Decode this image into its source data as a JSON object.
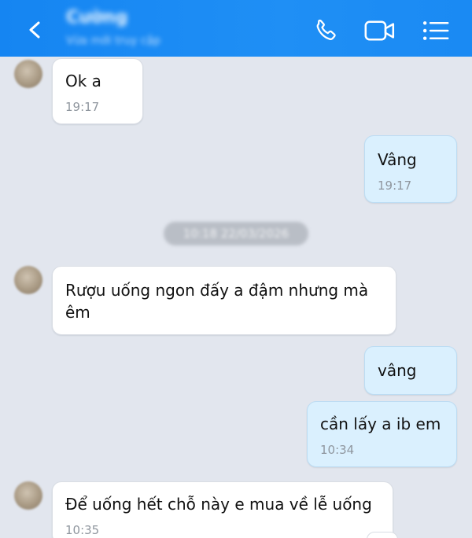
{
  "header": {
    "contact_name": "Cường",
    "status": "Vừa mới truy cập",
    "icons": [
      "back-icon",
      "call-icon",
      "video-call-icon",
      "menu-icon"
    ]
  },
  "date_separator": "10:18 22/03/2026",
  "messages": [
    {
      "direction": "in",
      "text": "Ok a",
      "time": "19:17"
    },
    {
      "direction": "out",
      "text": "Vâng",
      "time": "19:17"
    },
    {
      "direction": "in",
      "text_lines": [
        "Rượu uống ngon đấy a đậm nhưng mà",
        "êm"
      ],
      "time": ""
    },
    {
      "direction": "out",
      "text": "vâng",
      "time": ""
    },
    {
      "direction": "out",
      "text": "cần lấy a ib em",
      "time": "10:34"
    },
    {
      "direction": "in",
      "text": "Để uống hết chỗ này e mua về lễ uống",
      "time": "10:35"
    }
  ],
  "colors": {
    "header": "#1a8af3",
    "background": "#e2e6ee",
    "incoming_bubble": "#ffffff",
    "outgoing_bubble": "#daf0fe"
  }
}
